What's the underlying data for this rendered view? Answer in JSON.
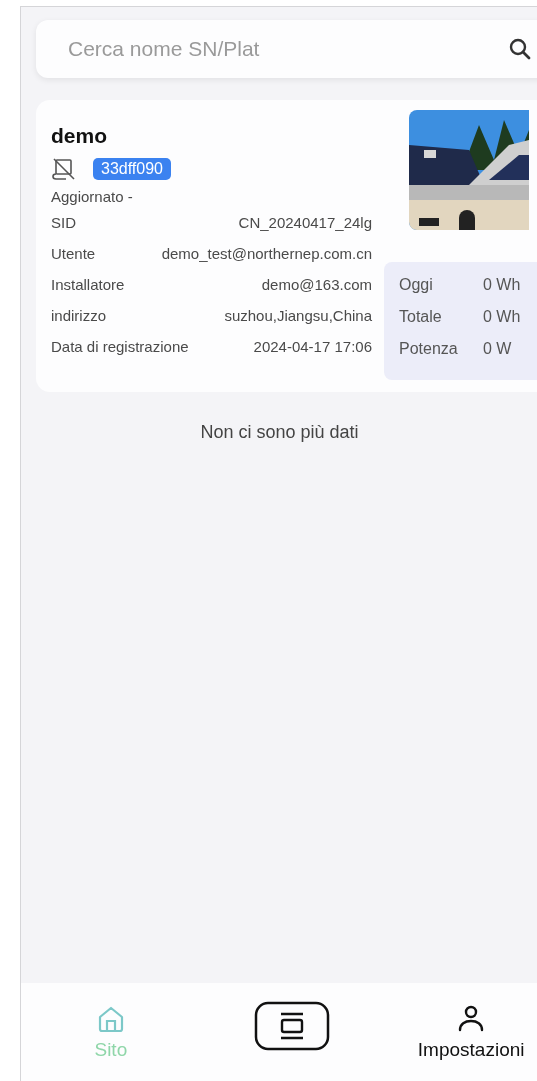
{
  "search": {
    "placeholder": "Cerca nome SN/Plat"
  },
  "sites": [
    {
      "name": "demo",
      "offline": true,
      "tag": "33dff090",
      "updated": "Aggiornato -",
      "fields": [
        {
          "label": "SID",
          "value": "CN_20240417_24lg"
        },
        {
          "label": "Utente",
          "value": "demo_test@northernep.com.cn"
        },
        {
          "label": "Installatore",
          "value": "demo@163.com"
        },
        {
          "label": "indirizzo",
          "value": "suzhou,Jiangsu,China"
        },
        {
          "label": "Data di registrazione",
          "value": "2024-04-17 17:06"
        }
      ],
      "stats": [
        {
          "label": "Oggi",
          "value": "0 Wh"
        },
        {
          "label": "Totale",
          "value": "0 Wh"
        },
        {
          "label": "Potenza",
          "value": "0 W"
        }
      ]
    }
  ],
  "end_text": "Non ci sono più dati",
  "nav": [
    {
      "kind": "home",
      "label": "Sito",
      "selected": true
    },
    {
      "kind": "center",
      "selected": false
    },
    {
      "kind": "user",
      "label": "Impostazioni",
      "selected": false
    }
  ]
}
